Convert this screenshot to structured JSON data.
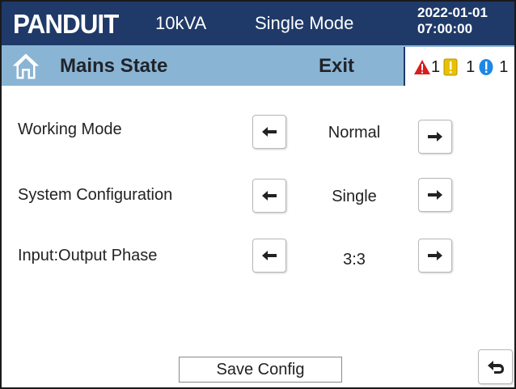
{
  "header": {
    "brand": "PANDUIT",
    "capacity": "10kVA",
    "mode": "Single Mode",
    "date": "2022-01-01",
    "time": "07:00:00"
  },
  "subheader": {
    "title": "Mains State",
    "exit_label": "Exit",
    "alarms": [
      {
        "icon": "critical-alarm-icon",
        "count": "1",
        "color": "#d81e1e"
      },
      {
        "icon": "warning-alarm-icon",
        "count": "1",
        "color": "#e8c100"
      },
      {
        "icon": "info-alarm-icon",
        "count": "1",
        "color": "#1e88e5"
      }
    ]
  },
  "settings": [
    {
      "label": "Working Mode",
      "value": "Normal"
    },
    {
      "label": "System Configuration",
      "value": "Single"
    },
    {
      "label": "Input:Output Phase",
      "value": "3:3"
    }
  ],
  "footer": {
    "save_label": "Save Config"
  },
  "colors": {
    "header_bg": "#1f3a68",
    "subheader_bg": "#8ab4d4"
  }
}
